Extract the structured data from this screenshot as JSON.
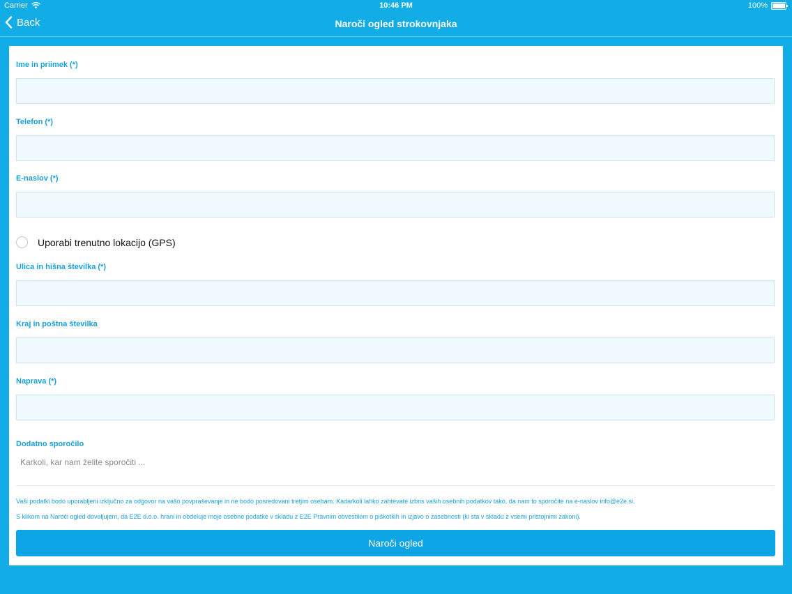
{
  "status_bar": {
    "carrier": "Carrier",
    "time": "10:46 PM",
    "battery": "100%",
    "icons": [
      "wifi-icon",
      "battery-icon"
    ]
  },
  "nav": {
    "back_label": "Back",
    "back_icon": "chevron-left-icon",
    "title": "Naroči ogled strokovnjaka"
  },
  "form": {
    "name_label": "Ime in priimek (*)",
    "phone_label": "Telefon (*)",
    "email_label": "E-naslov (*)",
    "gps_label": "Uporabi trenutno lokacijo (GPS)",
    "street_label": "Ulica in hišna številka (*)",
    "city_label": "Kraj in poštna številka",
    "device_label": "Naprava (*)",
    "message_label": "Dodatno sporočilo",
    "message_placeholder": "Karkoli, kar nam želite sporočiti ...",
    "notice_1": "Vaši podatki bodo uporabljeni izključno za odgovor na vašo povpraševanje in ne bodo posredovani tretjim osebam. Kadarkoli lahko zahtevate izbris vaših osebnih podatkov tako, da nam to sporočite na e-naslov info@e2e.si.",
    "notice_2": "S klikom na Naroči ogled dovoljujem, da E2E d.o.o. hrani in obdeluje moje osebne podatke v skladu z E2E Pravnim obvestilom o piškotkih in izjavo o zasebnosti (ki sta v skladu z vsemi pristojnimi zakoni).",
    "submit_label": "Naroči ogled"
  },
  "colors": {
    "background": "#12ade6",
    "accent": "#1aa0d8",
    "button": "#0ea5e6",
    "field_fill": "#eff9fe"
  }
}
